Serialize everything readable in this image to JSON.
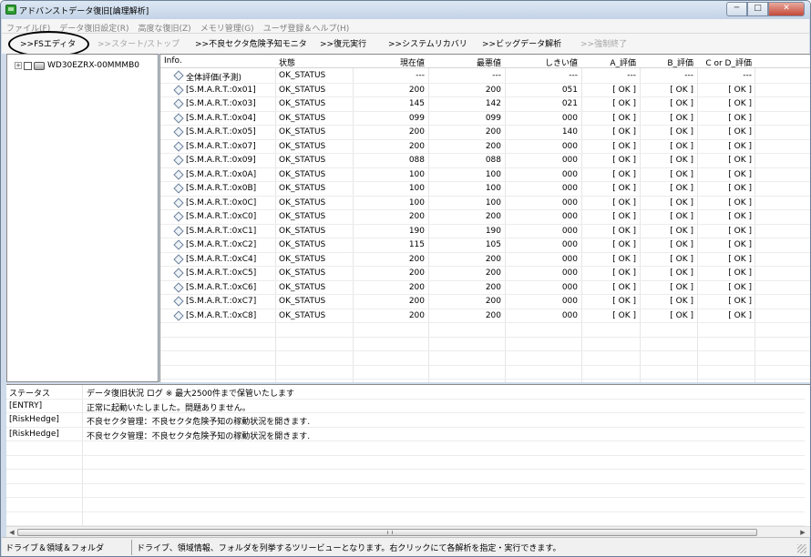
{
  "window": {
    "title": "アドバンストデータ復旧[論理解析]",
    "min": "─",
    "max": "□",
    "close": "✕"
  },
  "menu": [
    "ファイル(F)",
    "データ復旧設定(R)",
    "高度な復旧(Z)",
    "メモリ管理(G)",
    "ユーザ登録＆ヘルプ(H)"
  ],
  "toolbar": {
    "fs_editor": ">>FSエディタ",
    "start_stop": ">>スタート/ストップ",
    "bad_sector": ">>不良セクタ危険予知モニタ",
    "restore": ">>復元実行",
    "system_recovery": ">>システムリカバリ",
    "bigdata": ">>ビッグデータ解析",
    "force_quit": ">>強制終了"
  },
  "tree": {
    "expander": "+",
    "drive_label": "WD30EZRX-00MMMB0"
  },
  "grid": {
    "headers": {
      "info": "Info.",
      "status": "状態",
      "current": "現在値",
      "worst": "最悪値",
      "threshold": "しきい値",
      "a": "A_評価",
      "b": "B_評価",
      "cd": "C or D_評価"
    },
    "rows": [
      {
        "info": "全体評価(予測)",
        "status": "OK_STATUS",
        "current": "---",
        "worst": "---",
        "threshold": "---",
        "a": "---",
        "b": "---",
        "cd": "---"
      },
      {
        "info": "[S.M.A.R.T.:0x01]",
        "status": "OK_STATUS",
        "current": "200",
        "worst": "200",
        "threshold": "051",
        "a": "[ OK ]",
        "b": "[ OK ]",
        "cd": "[ OK ]"
      },
      {
        "info": "[S.M.A.R.T.:0x03]",
        "status": "OK_STATUS",
        "current": "145",
        "worst": "142",
        "threshold": "021",
        "a": "[ OK ]",
        "b": "[ OK ]",
        "cd": "[ OK ]"
      },
      {
        "info": "[S.M.A.R.T.:0x04]",
        "status": "OK_STATUS",
        "current": "099",
        "worst": "099",
        "threshold": "000",
        "a": "[ OK ]",
        "b": "[ OK ]",
        "cd": "[ OK ]"
      },
      {
        "info": "[S.M.A.R.T.:0x05]",
        "status": "OK_STATUS",
        "current": "200",
        "worst": "200",
        "threshold": "140",
        "a": "[ OK ]",
        "b": "[ OK ]",
        "cd": "[ OK ]"
      },
      {
        "info": "[S.M.A.R.T.:0x07]",
        "status": "OK_STATUS",
        "current": "200",
        "worst": "200",
        "threshold": "000",
        "a": "[ OK ]",
        "b": "[ OK ]",
        "cd": "[ OK ]"
      },
      {
        "info": "[S.M.A.R.T.:0x09]",
        "status": "OK_STATUS",
        "current": "088",
        "worst": "088",
        "threshold": "000",
        "a": "[ OK ]",
        "b": "[ OK ]",
        "cd": "[ OK ]"
      },
      {
        "info": "[S.M.A.R.T.:0x0A]",
        "status": "OK_STATUS",
        "current": "100",
        "worst": "100",
        "threshold": "000",
        "a": "[ OK ]",
        "b": "[ OK ]",
        "cd": "[ OK ]"
      },
      {
        "info": "[S.M.A.R.T.:0x0B]",
        "status": "OK_STATUS",
        "current": "100",
        "worst": "100",
        "threshold": "000",
        "a": "[ OK ]",
        "b": "[ OK ]",
        "cd": "[ OK ]"
      },
      {
        "info": "[S.M.A.R.T.:0x0C]",
        "status": "OK_STATUS",
        "current": "100",
        "worst": "100",
        "threshold": "000",
        "a": "[ OK ]",
        "b": "[ OK ]",
        "cd": "[ OK ]"
      },
      {
        "info": "[S.M.A.R.T.:0xC0]",
        "status": "OK_STATUS",
        "current": "200",
        "worst": "200",
        "threshold": "000",
        "a": "[ OK ]",
        "b": "[ OK ]",
        "cd": "[ OK ]"
      },
      {
        "info": "[S.M.A.R.T.:0xC1]",
        "status": "OK_STATUS",
        "current": "190",
        "worst": "190",
        "threshold": "000",
        "a": "[ OK ]",
        "b": "[ OK ]",
        "cd": "[ OK ]"
      },
      {
        "info": "[S.M.A.R.T.:0xC2]",
        "status": "OK_STATUS",
        "current": "115",
        "worst": "105",
        "threshold": "000",
        "a": "[ OK ]",
        "b": "[ OK ]",
        "cd": "[ OK ]"
      },
      {
        "info": "[S.M.A.R.T.:0xC4]",
        "status": "OK_STATUS",
        "current": "200",
        "worst": "200",
        "threshold": "000",
        "a": "[ OK ]",
        "b": "[ OK ]",
        "cd": "[ OK ]"
      },
      {
        "info": "[S.M.A.R.T.:0xC5]",
        "status": "OK_STATUS",
        "current": "200",
        "worst": "200",
        "threshold": "000",
        "a": "[ OK ]",
        "b": "[ OK ]",
        "cd": "[ OK ]"
      },
      {
        "info": "[S.M.A.R.T.:0xC6]",
        "status": "OK_STATUS",
        "current": "200",
        "worst": "200",
        "threshold": "000",
        "a": "[ OK ]",
        "b": "[ OK ]",
        "cd": "[ OK ]"
      },
      {
        "info": "[S.M.A.R.T.:0xC7]",
        "status": "OK_STATUS",
        "current": "200",
        "worst": "200",
        "threshold": "000",
        "a": "[ OK ]",
        "b": "[ OK ]",
        "cd": "[ OK ]"
      },
      {
        "info": "[S.M.A.R.T.:0xC8]",
        "status": "OK_STATUS",
        "current": "200",
        "worst": "200",
        "threshold": "000",
        "a": "[ OK ]",
        "b": "[ OK ]",
        "cd": "[ OK ]"
      }
    ]
  },
  "log": {
    "headers": {
      "status": "ステータス",
      "message": "データ復旧状況 ログ ※ 最大2500件まで保管いたします"
    },
    "rows": [
      {
        "status": "[ENTRY]",
        "message": "正常に起動いたしました。問題ありません。"
      },
      {
        "status": "[RiskHedge]",
        "message": "不良セクタ管理：不良セクタ危険予知の稼動状況を開きます."
      },
      {
        "status": "[RiskHedge]",
        "message": "不良セクタ管理：不良セクタ危険予知の稼動状況を開きます."
      }
    ]
  },
  "statusbar": {
    "left": "ドライブ＆領域＆フォルダ",
    "right": "ドライブ、領域情報、フォルダを列挙するツリービューとなります。右クリックにて各解析を指定・実行できます。"
  }
}
